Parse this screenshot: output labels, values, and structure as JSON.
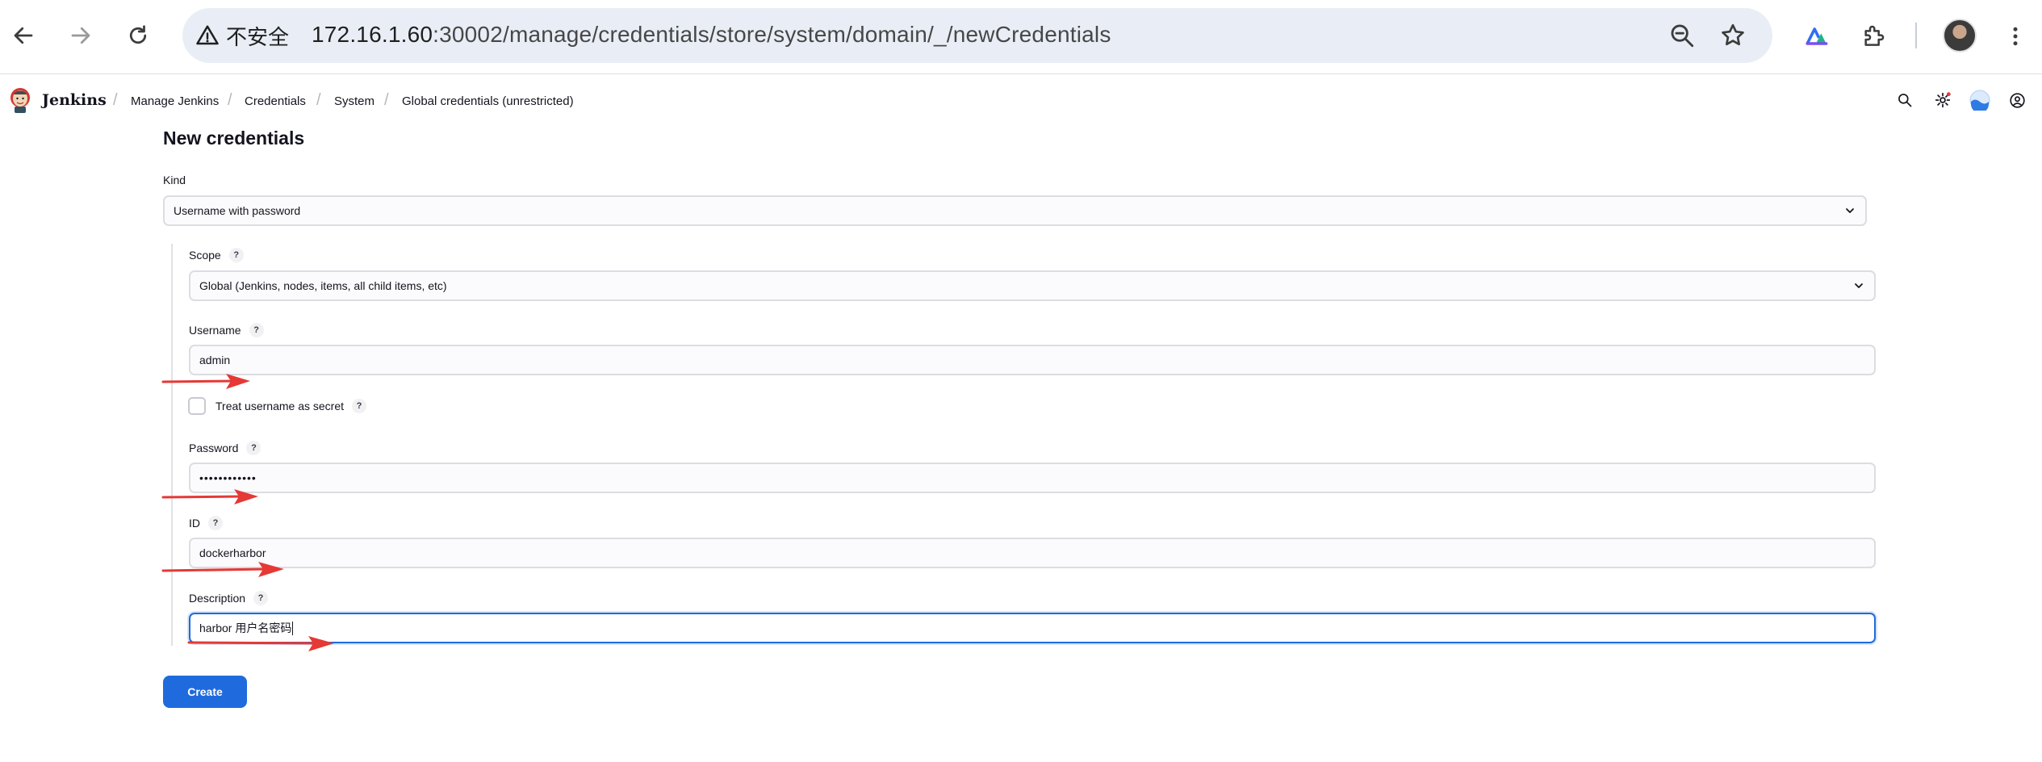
{
  "browser": {
    "security_label": "不安全",
    "url_host": "172.16.1.60",
    "url_path": ":30002/manage/credentials/store/system/domain/_/newCredentials"
  },
  "header": {
    "brand": "Jenkins",
    "breadcrumbs": [
      "Manage Jenkins",
      "Credentials",
      "System",
      "Global credentials (unrestricted)"
    ]
  },
  "form": {
    "title": "New credentials",
    "kind_label": "Kind",
    "kind_value": "Username with password",
    "scope_label": "Scope",
    "scope_value": "Global (Jenkins, nodes, items, all child items, etc)",
    "username_label": "Username",
    "username_value": "admin",
    "treat_secret_label": "Treat username as secret",
    "treat_secret_checked": false,
    "password_label": "Password",
    "password_value": "••••••••••••",
    "id_label": "ID",
    "id_value": "dockerharbor",
    "description_label": "Description",
    "description_value": "harbor 用户名密码",
    "help_glyph": "?",
    "create_label": "Create"
  },
  "colors": {
    "accent": "#1f6bdd",
    "annotation_arrow": "#e53935"
  }
}
